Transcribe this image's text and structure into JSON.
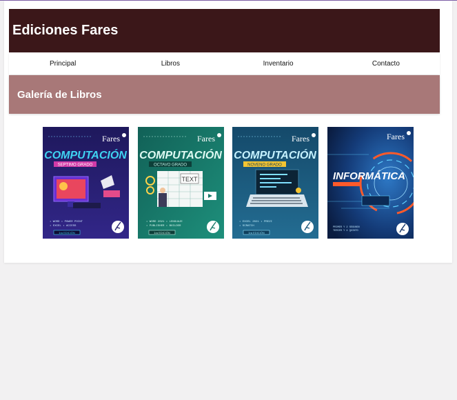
{
  "brand": {
    "name": "Ediciones Fares"
  },
  "nav": {
    "items": [
      "Principal",
      "Libros",
      "Inventario",
      "Contacto"
    ]
  },
  "banner": {
    "title": "Galería de Libros"
  },
  "books": [
    {
      "title": "COMPUTACIÓN",
      "grade": "SEPTIMO GRADO",
      "publisher": "Fares",
      "edition": "1ra EDICIÓN",
      "bg": "#241f6e",
      "accent": "#3fd3f2"
    },
    {
      "title": "COMPUTACIÓN",
      "grade": "OCTAVO GRADO",
      "publisher": "Fares",
      "edition": "1ra EDICIÓN",
      "bg": "#187868",
      "accent": "#bff3e8"
    },
    {
      "title": "COMPUTACIÓN",
      "grade": "NOVENO GRADO",
      "publisher": "Fares",
      "edition": "1ra EDICIÓN",
      "bg": "#1b567a",
      "accent": "#8fe3ff"
    },
    {
      "title": "INFORMÁTICA",
      "grade": "",
      "publisher": "Fares",
      "edition": "",
      "bg": "#0f2f66",
      "accent": "#ff5a2a"
    }
  ],
  "icons": [
    "fares-logo-icon",
    "feather-seal-icon"
  ]
}
